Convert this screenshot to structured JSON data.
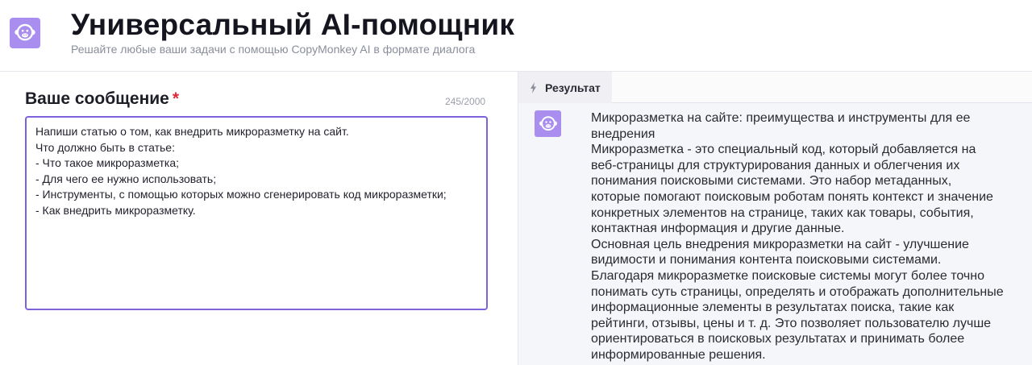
{
  "header": {
    "logo_icon": "monkey-icon",
    "title": "Универсальный AI-помощник",
    "subtitle": "Решайте любые ваши задачи с помощью CopyMonkey AI в формате диалога"
  },
  "message": {
    "label": "Ваше сообщение",
    "required_mark": "*",
    "counter": "245/2000",
    "lines": [
      "Напиши статью о том, как внедрить микроразметку на сайт.",
      "Что должно быть в статье:",
      "- Что такое микроразметка;",
      "- Для чего ее нужно использовать;",
      "- Инструменты, с помощью которых можно сгенерировать код микроразметки;",
      "- Как внедрить микроразметку."
    ]
  },
  "result": {
    "tab_icon": "lightning-icon",
    "tab_label": "Результат",
    "avatar_icon": "monkey-icon",
    "lines": [
      "Микроразметка на сайте: преимущества и инструменты для ее",
      "внедрения",
      "Микроразметка - это специальный код, который добавляется на",
      "веб-страницы для структурирования данных и облегчения их",
      "понимания поисковыми системами. Это набор метаданных,",
      "которые помогают поисковым роботам понять контекст и значение",
      "конкретных элементов на странице, таких как товары, события,",
      "контактная информация и другие данные.",
      "Основная цель внедрения микроразметки на сайт - улучшение",
      "видимости и понимания контента поисковыми системами.",
      "Благодаря микроразметке поисковые системы могут более точно",
      "понимать суть страницы, определять и отображать дополнительные",
      "информационные элементы в результатах поиска, такие как",
      "рейтинги, отзывы, цены и т. д. Это позволяет пользователю лучше",
      "ориентироваться в поисковых результатах и принимать более",
      "информированные решения."
    ]
  },
  "colors": {
    "accent": "#7e62dc",
    "logo_bg": "#a98ef0",
    "required": "#e0293b"
  }
}
